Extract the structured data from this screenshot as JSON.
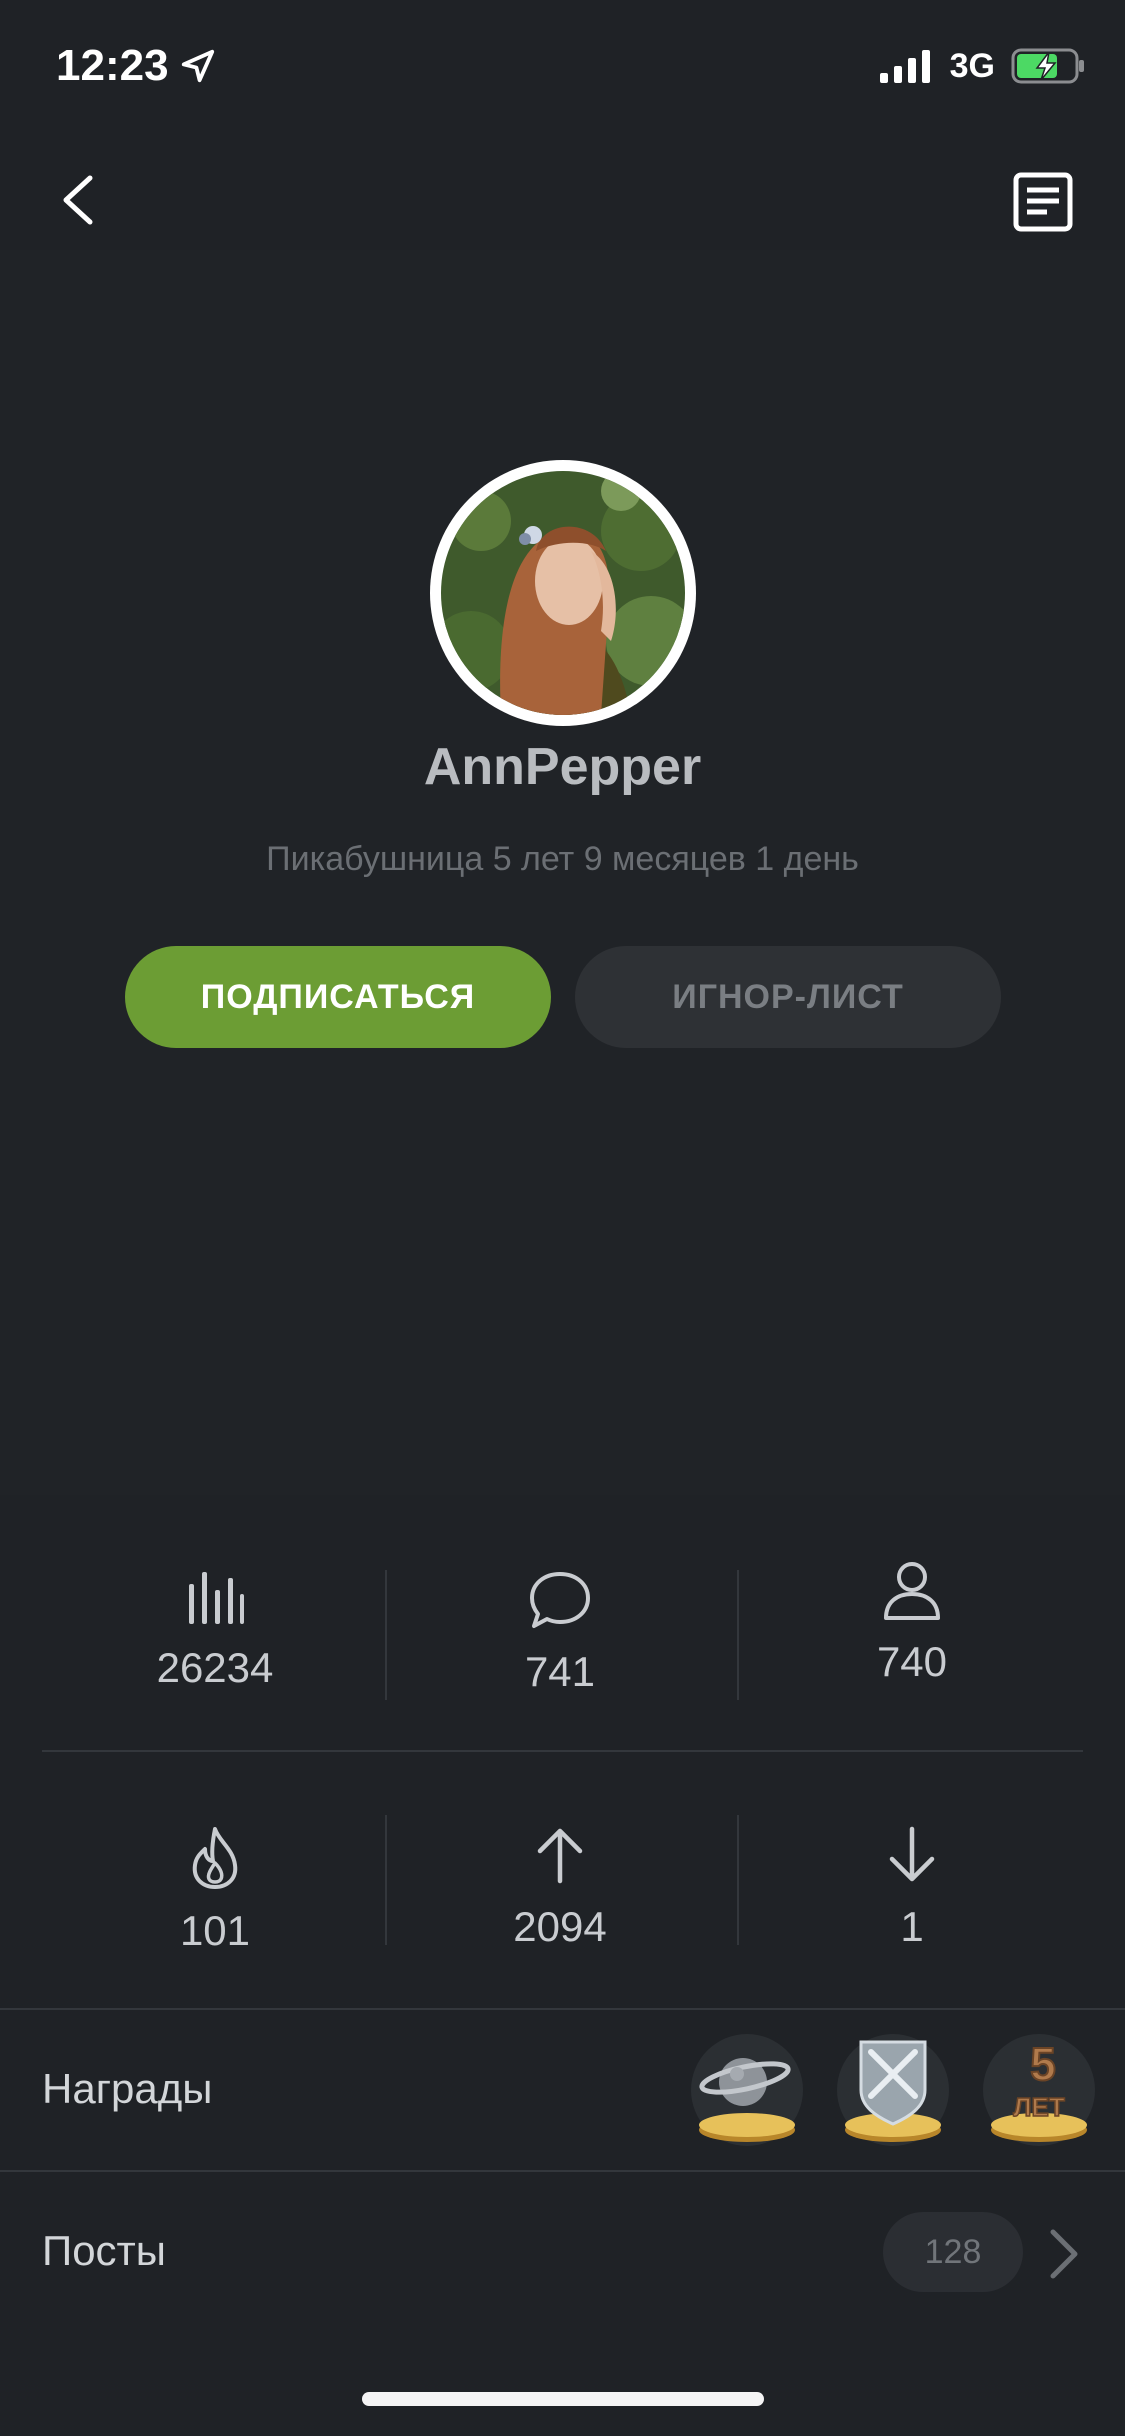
{
  "status_bar": {
    "time": "12:23",
    "network": "3G",
    "icons": [
      "location-arrow-icon",
      "signal-icon",
      "battery-charging-icon"
    ]
  },
  "topbar": {
    "back_icon": "chevron-left-icon",
    "menu_icon": "notes-icon"
  },
  "profile": {
    "username": "AnnPepper",
    "tenure": "Пикабушница 5 лет 9 месяцев 1 день",
    "subscribe_label": "ПОДПИСАТЬСЯ",
    "ignore_label": "ИГНОР-ЛИСТ"
  },
  "stats": [
    {
      "icon": "rating-bars-icon",
      "value": "26234"
    },
    {
      "icon": "comment-icon",
      "value": "741"
    },
    {
      "icon": "user-icon",
      "value": "740"
    },
    {
      "icon": "fire-icon",
      "value": "101"
    },
    {
      "icon": "arrow-up-icon",
      "value": "2094"
    },
    {
      "icon": "arrow-down-icon",
      "value": "1"
    }
  ],
  "awards": {
    "label": "Награды",
    "items": [
      {
        "icon": "planet-award-icon"
      },
      {
        "icon": "shield-swords-award-icon"
      },
      {
        "icon": "five-years-award-icon",
        "text": "5 ЛЕТ"
      }
    ]
  },
  "posts": {
    "label": "Посты",
    "count": "128"
  },
  "colors": {
    "background": "#1f2226",
    "accent_green": "#6c9d34",
    "ignore_button": "#2e3135",
    "divider": "#33373c"
  }
}
